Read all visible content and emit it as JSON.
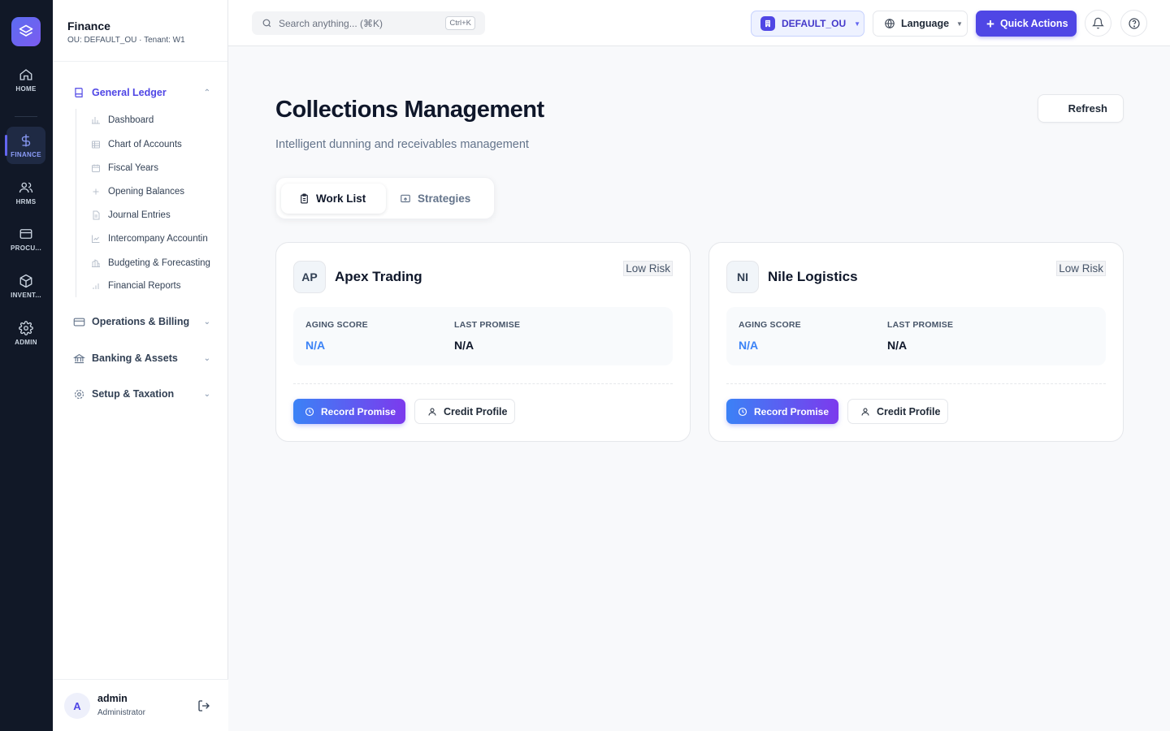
{
  "rail": {
    "items": [
      {
        "label": "HOME"
      },
      {
        "label": "FINANCE"
      },
      {
        "label": "HRMS"
      },
      {
        "label": "PROCU..."
      },
      {
        "label": "INVENT..."
      },
      {
        "label": "ADMIN"
      }
    ]
  },
  "sidebar": {
    "title": "Finance",
    "subtitle": "OU: DEFAULT_OU · Tenant: W1",
    "groups": [
      {
        "label": "General Ledger"
      },
      {
        "label": "Operations & Billing"
      },
      {
        "label": "Banking & Assets"
      },
      {
        "label": "Setup & Taxation"
      }
    ],
    "ledger_items": [
      {
        "label": "Dashboard"
      },
      {
        "label": "Chart of Accounts"
      },
      {
        "label": "Fiscal Years"
      },
      {
        "label": "Opening Balances"
      },
      {
        "label": "Journal Entries"
      },
      {
        "label": "Intercompany Accountin"
      },
      {
        "label": "Budgeting & Forecasting"
      },
      {
        "label": "Financial Reports"
      }
    ],
    "user": {
      "initial": "A",
      "name": "admin",
      "role": "Administrator"
    }
  },
  "topbar": {
    "search_placeholder": "Search anything... (⌘K)",
    "search_shortcut": "Ctrl+K",
    "ou_label": "DEFAULT_OU",
    "language_label": "Language",
    "quick_actions_label": "Quick Actions"
  },
  "main": {
    "title": "Collections Management",
    "subtitle": "Intelligent dunning and receivables management",
    "refresh_label": "Refresh",
    "tabs": [
      {
        "label": "Work List"
      },
      {
        "label": "Strategies"
      }
    ],
    "customers": [
      {
        "initials": "AP",
        "name": "Apex Trading",
        "risk": "Low Risk",
        "aging_label": "AGING SCORE",
        "aging_value": "N/A",
        "promise_label": "LAST PROMISE",
        "promise_value": "N/A",
        "record_label": "Record Promise",
        "credit_label": "Credit Profile"
      },
      {
        "initials": "NI",
        "name": "Nile Logistics",
        "risk": "Low Risk",
        "aging_label": "AGING SCORE",
        "aging_value": "N/A",
        "promise_label": "LAST PROMISE",
        "promise_value": "N/A",
        "record_label": "Record Promise",
        "credit_label": "Credit Profile"
      }
    ]
  },
  "colors": {
    "accent": "#4f46e5",
    "rail_bg": "#111827",
    "aging_value": "#3b82f6"
  }
}
